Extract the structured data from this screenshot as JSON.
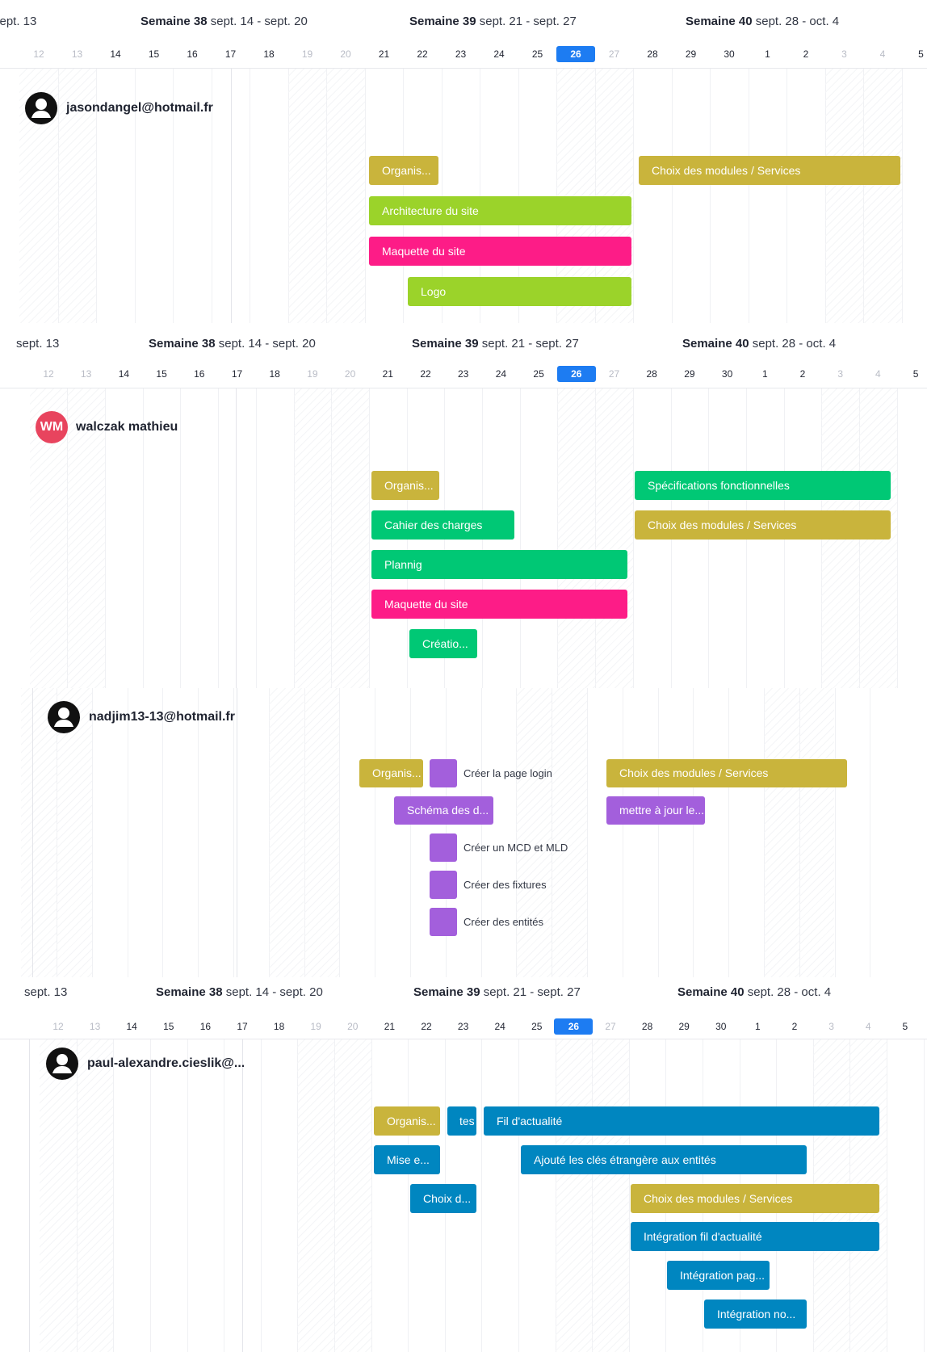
{
  "timeline": {
    "prev_label": "sept. 13",
    "weeks": [
      {
        "name": "Semaine 38",
        "range": "sept. 14 - sept. 20"
      },
      {
        "name": "Semaine 39",
        "range": "sept. 21 - sept. 27"
      },
      {
        "name": "Semaine 40",
        "range": "sept. 28 - oct. 4"
      }
    ],
    "days": [
      "12",
      "13",
      "14",
      "15",
      "16",
      "17",
      "18",
      "19",
      "20",
      "21",
      "22",
      "23",
      "24",
      "25",
      "26",
      "27",
      "28",
      "29",
      "30",
      "1",
      "2",
      "3",
      "4",
      "5"
    ],
    "weekend_days": [
      "12",
      "13",
      "19",
      "20",
      "26",
      "27",
      "3",
      "4"
    ],
    "today": "26"
  },
  "colors": {
    "olive": "#c9b43c",
    "lime": "#9bd32a",
    "pink": "#fd1c87",
    "green": "#00c875",
    "purple": "#a35fdc",
    "blue": "#0086c0",
    "today": "#1d7cf2",
    "initials_avatar": "#e8445e"
  },
  "panels": [
    {
      "user": {
        "name": "jasondangel@hotmail.fr",
        "avatar": "user-silhouette-icon"
      },
      "tasks": [
        {
          "label": "Organis...",
          "color": "olive"
        },
        {
          "label": "Choix des modules / Services",
          "color": "olive"
        },
        {
          "label": "Architecture du site",
          "color": "lime"
        },
        {
          "label": "Maquette du site",
          "color": "pink"
        },
        {
          "label": "Logo",
          "color": "lime"
        }
      ]
    },
    {
      "user": {
        "name": "walczak mathieu",
        "avatar": "WM"
      },
      "tasks": [
        {
          "label": "Organis...",
          "color": "olive"
        },
        {
          "label": "Spécifications fonctionnelles",
          "color": "green"
        },
        {
          "label": "Cahier des charges",
          "color": "green"
        },
        {
          "label": "Choix des modules / Services",
          "color": "olive"
        },
        {
          "label": "Plannig",
          "color": "green"
        },
        {
          "label": "Maquette du site",
          "color": "pink"
        },
        {
          "label": "Créatio...",
          "color": "green"
        }
      ]
    },
    {
      "user": {
        "name": "nadjim13-13@hotmail.fr",
        "avatar": "user-silhouette-icon"
      },
      "tasks": [
        {
          "label": "Organis...",
          "color": "olive"
        },
        {
          "label": "Créer la page login",
          "color": "purple"
        },
        {
          "label": "Choix des modules / Services",
          "color": "olive"
        },
        {
          "label": "Schéma des d...",
          "color": "purple"
        },
        {
          "label": "mettre à jour le...",
          "color": "purple"
        },
        {
          "label": "Créer un MCD et MLD",
          "color": "purple"
        },
        {
          "label": "Créer des fixtures",
          "color": "purple"
        },
        {
          "label": "Créer des entités",
          "color": "purple"
        }
      ]
    },
    {
      "user": {
        "name": "paul-alexandre.cieslik@...",
        "avatar": "user-silhouette-icon"
      },
      "tasks": [
        {
          "label": "Organis...",
          "color": "olive"
        },
        {
          "label": "tes",
          "color": "blue"
        },
        {
          "label": "Fil d'actualité",
          "color": "blue"
        },
        {
          "label": "Mise e...",
          "color": "blue"
        },
        {
          "label": "Ajouté les clés étrangère aux entités",
          "color": "blue"
        },
        {
          "label": "Choix d...",
          "color": "blue"
        },
        {
          "label": "Choix des modules / Services",
          "color": "olive"
        },
        {
          "label": "Intégration fil d'actualité",
          "color": "blue"
        },
        {
          "label": "Intégration pag...",
          "color": "blue"
        },
        {
          "label": "Intégration no...",
          "color": "blue"
        }
      ]
    }
  ]
}
